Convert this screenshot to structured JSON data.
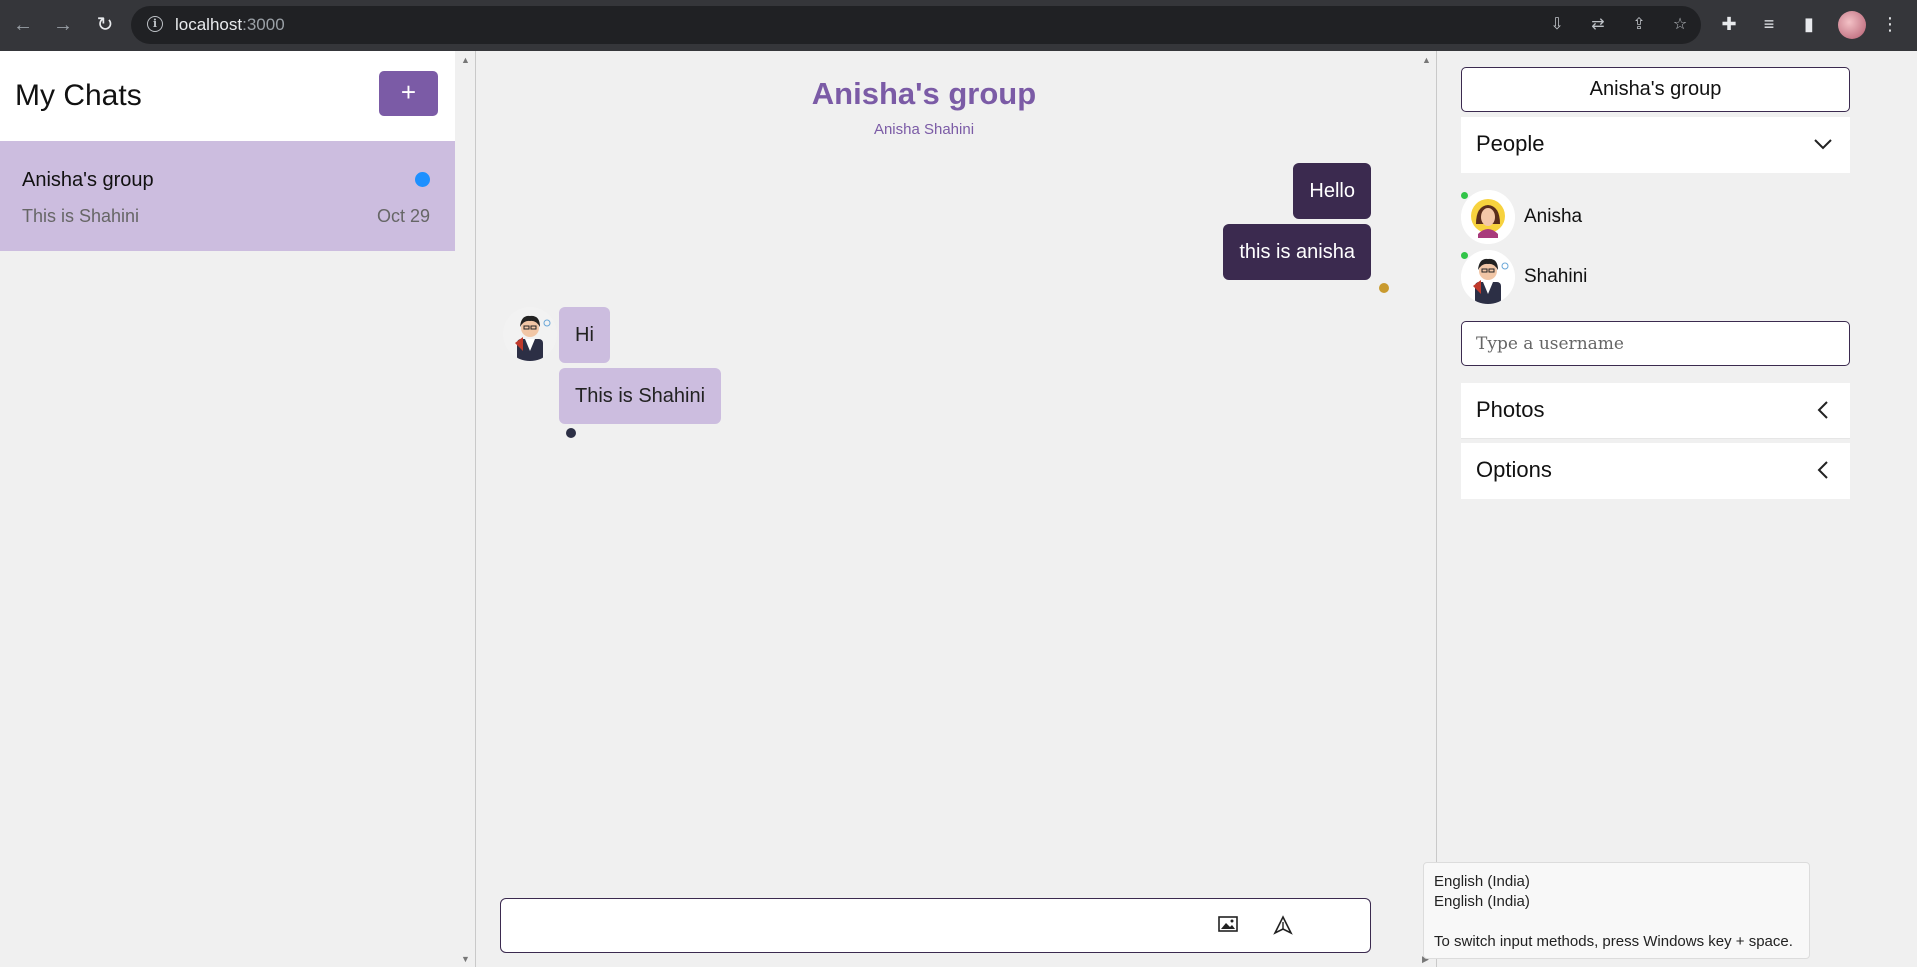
{
  "browser": {
    "url_host": "localhost",
    "url_port": ":3000",
    "icons": [
      "back-icon",
      "forward-icon",
      "reload-icon",
      "info-icon",
      "install-icon",
      "translate-icon",
      "share-icon",
      "bookmark-star-icon",
      "extensions-icon",
      "media-icon",
      "sidepanel-icon",
      "menu-icon"
    ]
  },
  "sidebar": {
    "title": "My Chats",
    "new_button": "+",
    "chats": [
      {
        "title": "Anisha's group",
        "preview": "This is Shahini",
        "date": "Oct 29",
        "unread": true
      }
    ]
  },
  "conversation": {
    "title": "Anisha's group",
    "subtitle": "Anisha Shahini",
    "messages": [
      {
        "text": "Hello",
        "direction": "out"
      },
      {
        "text": "this is anisha",
        "direction": "out"
      },
      {
        "text": "Hi",
        "direction": "in"
      },
      {
        "text": "This is Shahini",
        "direction": "in"
      }
    ],
    "composer_value": ""
  },
  "details": {
    "title": "Anisha's group",
    "people_label": "People",
    "people": [
      {
        "name": "Anisha",
        "online": true
      },
      {
        "name": "Shahini",
        "online": true
      }
    ],
    "username_placeholder": "Type a username",
    "photos_label": "Photos",
    "options_label": "Options"
  },
  "ime_tooltip": {
    "line1": "English (India)",
    "line2": "English (India)",
    "hint": "To switch input methods, press Windows key + space."
  },
  "colors": {
    "accent": "#7b5ba6",
    "outgoing_bubble": "#3b2a4f",
    "incoming_bubble": "#ccbddf",
    "unread_dot": "#1e90ff",
    "online": "#31c448"
  }
}
